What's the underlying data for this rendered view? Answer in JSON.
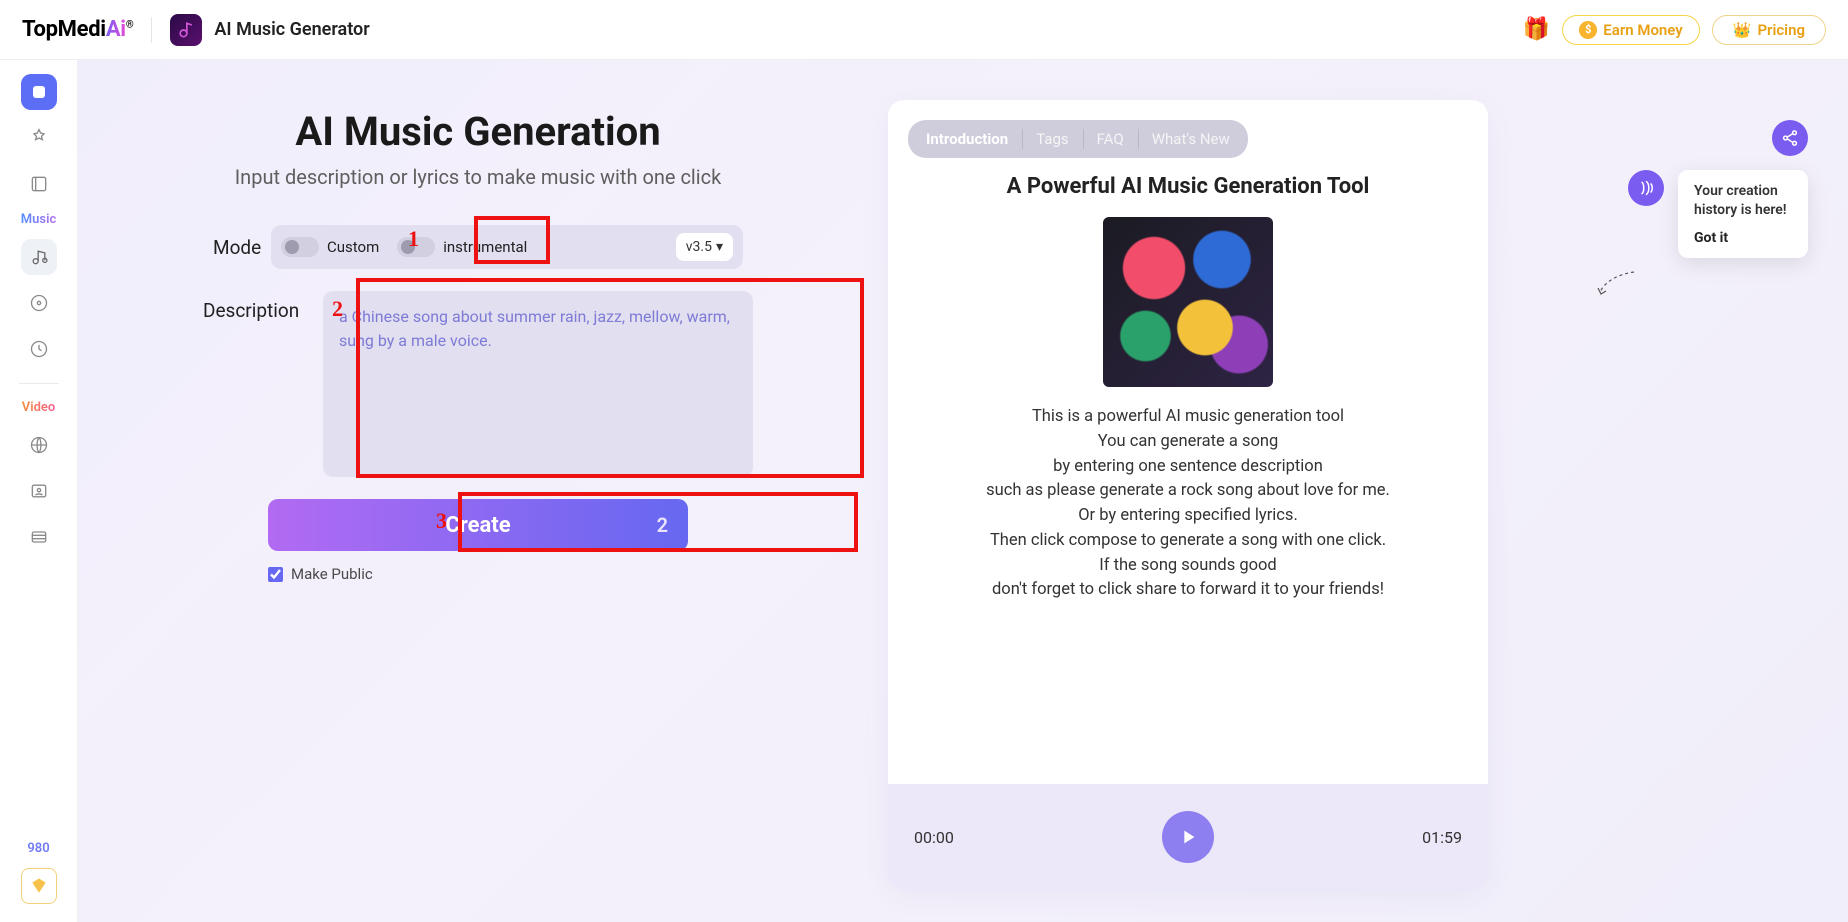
{
  "header": {
    "logo_main": "TopMedi",
    "logo_ai": "Ai",
    "logo_reg": "®",
    "app_title": "AI Music Generator",
    "earn_money": "Earn Money",
    "pricing": "Pricing"
  },
  "sidebar": {
    "section_music": "Music",
    "section_video": "Video",
    "credits": "980"
  },
  "gen": {
    "title": "AI Music Generation",
    "subtitle": "Input description or lyrics to make music with one click",
    "mode_label": "Mode",
    "custom_label": "Custom",
    "instrumental_label": "instrumental",
    "version": "v3.5",
    "description_label": "Description",
    "description_placeholder": "a Chinese song about summer rain, jazz, mellow, warm, sung by a male voice.",
    "create_label": "Create",
    "create_count": "2",
    "make_public_label": "Make Public",
    "make_public_checked": true
  },
  "annotations": {
    "n1": "1",
    "n2": "2",
    "n3": "3"
  },
  "info": {
    "tabs": {
      "introduction": "Introduction",
      "tags": "Tags",
      "faq": "FAQ",
      "whats_new": "What's New"
    },
    "card_title": "A Powerful AI Music Generation Tool",
    "body": "This is a powerful AI music generation tool\nYou can generate a song\nby entering one sentence description\nsuch as please generate a rock song about love for me.\nOr by entering specified lyrics.\nThen click compose to generate a song with one click.\nIf the song sounds good\ndon't forget to click share to forward it to your friends!",
    "time_start": "00:00",
    "time_end": "01:59"
  },
  "tip": {
    "text": "Your creation history is here!",
    "got_it": "Got it"
  }
}
